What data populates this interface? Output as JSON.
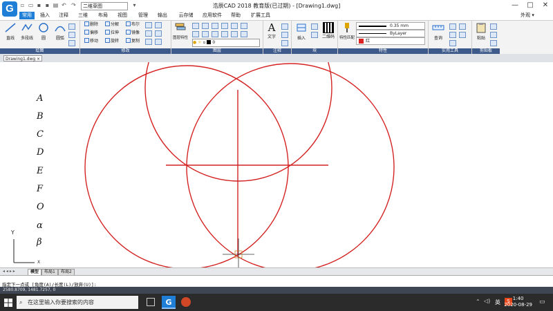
{
  "window": {
    "title": "浩辰CAD 2018 教育版(已过期) - [Drawing1.dwg]",
    "minimize": "—",
    "maximize": "□",
    "close": "✕",
    "appearance_label": "外观 ▾",
    "workspace": "二维草图"
  },
  "tabs": [
    "常用",
    "插入",
    "注释",
    "三维",
    "布局",
    "视图",
    "管理",
    "输出",
    "云存储",
    "应用软件",
    "帮助",
    "扩展工具"
  ],
  "ribbon": {
    "draw": {
      "label": "绘图",
      "line": "直线",
      "polyline": "多段线",
      "circle": "圆",
      "arc": "圆弧"
    },
    "modify": {
      "label": "修改",
      "items": [
        "删除",
        "分解",
        "布尔",
        "偏移",
        "拉伸",
        "镜像",
        "移动",
        "旋转",
        "复制"
      ]
    },
    "layers": {
      "label": "图层",
      "properties": "图层特性",
      "current": "0"
    },
    "annotation": {
      "label": "注释",
      "text": "文字"
    },
    "block": {
      "label": "块",
      "insert": "插入",
      "qrcode": "二维码"
    },
    "properties": {
      "label": "特性",
      "match": "特性匹配",
      "lineweight": "0.35 mm",
      "linetype": "ByLayer",
      "color": "红",
      "color_hex": "#dd2222"
    },
    "utilities": {
      "label": "实用工具",
      "query": "查询"
    },
    "clipboard": {
      "label": "剪贴板",
      "paste": "粘贴"
    }
  },
  "document_tab": "Drawing1.dwg",
  "canvas": {
    "labels": [
      "A",
      "B",
      "C",
      "D",
      "E",
      "F",
      "O",
      "α",
      "β"
    ],
    "axis_y": "Y",
    "axis_x": "X",
    "drawing_color": "#d42222"
  },
  "layout_tabs": [
    "模型",
    "布局1",
    "布局2"
  ],
  "command_prompt": "指定下一点或 [角度(A)/长度(L)/放弃(U)]:",
  "coordinates": "2580.8709, 1481.7257, 0",
  "taskbar": {
    "search_placeholder": "在这里输入你要搜索的内容",
    "time": "1:40",
    "date": "2020-08-29",
    "input_method": "英",
    "ime_badge": "S"
  }
}
